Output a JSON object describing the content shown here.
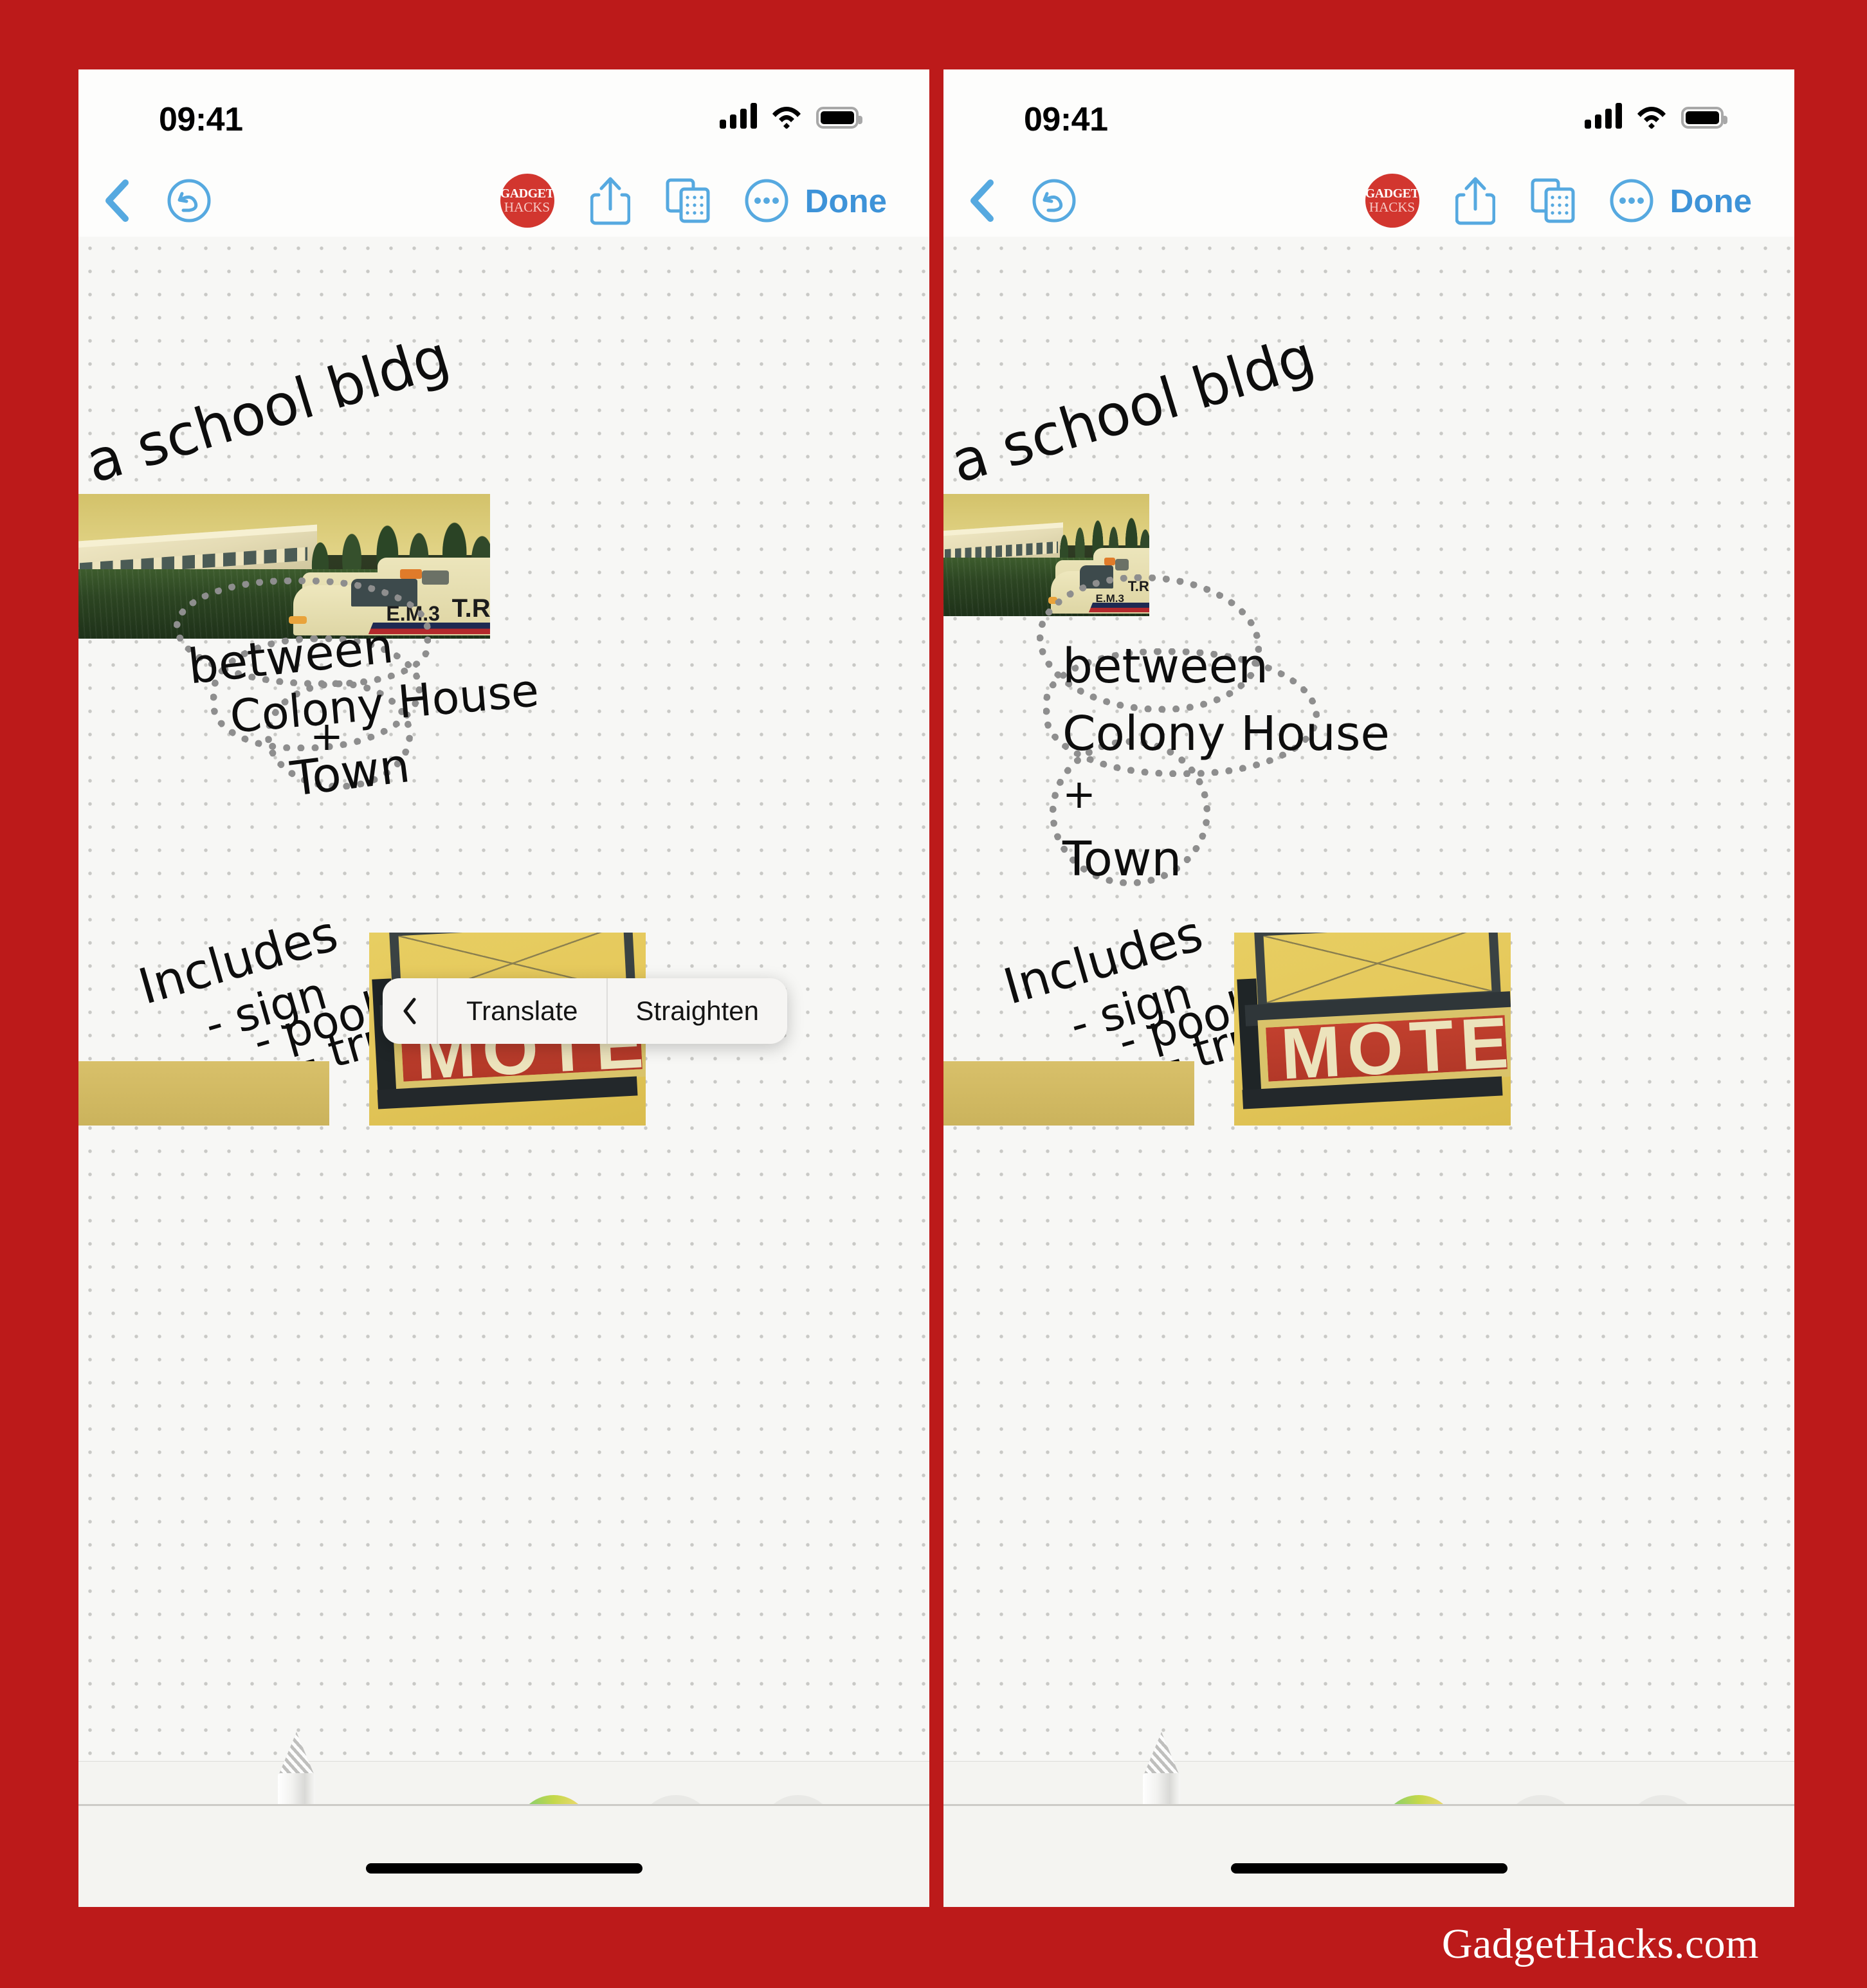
{
  "page": {
    "background_color": "#bc1a1a",
    "watermark": "GadgetHacks.com"
  },
  "panels": [
    {
      "id": "left",
      "status_bar": {
        "time": "09:41",
        "signal_icon": "cellular-bars-icon",
        "wifi_icon": "wifi-icon",
        "battery_icon": "battery-full-icon"
      },
      "toolbar": {
        "back_label": "back-chevron",
        "undo_label": "undo",
        "brand_top": "GADGET",
        "brand_bottom": "HACKS",
        "share_label": "share",
        "pages_label": "pages",
        "more_label": "more",
        "done_label": "Done"
      },
      "notes": {
        "line1": "a school bldg",
        "selection_text": "between Colony House + Town",
        "sel_word1": "between",
        "sel_word2": "Colony House",
        "sel_word3": "+",
        "sel_word4": "Town",
        "list_title": "Includes",
        "list_item1": "- sign",
        "list_item2": "- pool",
        "list_item3": "- truck"
      },
      "photos": {
        "scene_label_1": "T.R.",
        "scene_label_2": "E.M.3",
        "motel_label": "MOTE"
      },
      "popup": {
        "visible": true,
        "back_icon": "chevron-left-icon",
        "items": [
          "Translate",
          "Straighten"
        ]
      },
      "tools": {
        "pencil": "apple-pencil",
        "color": "color-wheel",
        "layer_front": "move-to-front",
        "layer_back": "move-to-back",
        "selected_color": "#000000"
      }
    },
    {
      "id": "right",
      "status_bar": {
        "time": "09:41",
        "signal_icon": "cellular-bars-icon",
        "wifi_icon": "wifi-icon",
        "battery_icon": "battery-full-icon"
      },
      "toolbar": {
        "back_label": "back-chevron",
        "undo_label": "undo",
        "brand_top": "GADGET",
        "brand_bottom": "HACKS",
        "share_label": "share",
        "pages_label": "pages",
        "more_label": "more",
        "done_label": "Done"
      },
      "notes": {
        "line1": "a school bldg",
        "selection_text": "between Colony House + Town",
        "sel_word1": "between",
        "sel_word2": "Colony House",
        "sel_word3": "+",
        "sel_word4": "Town",
        "list_title": "Includes",
        "list_item1": "- sign",
        "list_item2": "- pool",
        "list_item3": "- truck"
      },
      "photos": {
        "scene_label_1": "T.R.",
        "scene_label_2": "E.M.3",
        "motel_label": "MOTE"
      },
      "popup": {
        "visible": false,
        "back_icon": "chevron-left-icon",
        "items": []
      },
      "tools": {
        "pencil": "apple-pencil",
        "color": "color-wheel",
        "layer_front": "move-to-front",
        "layer_back": "move-to-back",
        "selected_color": "#000000"
      }
    }
  ]
}
